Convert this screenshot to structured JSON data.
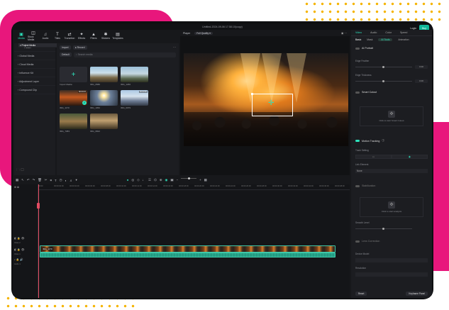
{
  "window": {
    "title": "Untitled-2024-09-06 17.58.10(copy)",
    "login": "Login",
    "buy": "Buy"
  },
  "toolbar": [
    {
      "label": "Media",
      "icon": "media-icon",
      "active": true
    },
    {
      "label": "Stock Media",
      "icon": "stock-media-icon"
    },
    {
      "label": "Audio",
      "icon": "audio-icon"
    },
    {
      "label": "Titles",
      "icon": "titles-icon"
    },
    {
      "label": "Transition",
      "icon": "transition-icon"
    },
    {
      "label": "Effects",
      "icon": "effects-icon"
    },
    {
      "label": "Filters",
      "icon": "filters-icon"
    },
    {
      "label": "Stickers",
      "icon": "stickers-icon"
    },
    {
      "label": "Templates",
      "icon": "templates-icon"
    }
  ],
  "sidebar": {
    "items": [
      "Project Media",
      "Folder",
      "Global Media",
      "Cloud Media",
      "Influence Kit",
      "Adjustment Layer",
      "Compound Clip"
    ]
  },
  "media": {
    "import_label": "Import",
    "record_label": "Record",
    "sort_label": "Default",
    "search_placeholder": "Search media",
    "items": [
      {
        "name": "Import Media",
        "kind": "import"
      },
      {
        "name": "IMG_0580",
        "kind": "t1"
      },
      {
        "name": "IMG_1266",
        "kind": "t2"
      },
      {
        "name": "IMG_1170",
        "kind": "t3",
        "duration": "00:00:15",
        "checked": true
      },
      {
        "name": "IMG_1052",
        "kind": "t4"
      },
      {
        "name": "IMG_0979",
        "kind": "t5",
        "duration": "00:00:50"
      },
      {
        "name": "IMG_7083",
        "kind": "t6"
      },
      {
        "name": "IMG_6822",
        "kind": "t7"
      }
    ]
  },
  "player": {
    "tab": "Player",
    "quality": "Full Quality",
    "current_time": "00:00:00:00",
    "total_time": "00:00:12:17"
  },
  "right_panel": {
    "tabs": [
      "Video",
      "Audio",
      "Color",
      "Speed"
    ],
    "subtabs": [
      "Basic",
      "Mask",
      "AI Tools",
      "Animation"
    ],
    "ai_portrait": "AI Portrait",
    "edge_feather": "Edge Feather",
    "edge_thickness": "Edge Thickness",
    "edge_feather_value": "0.00",
    "edge_thickness_value": "0.00",
    "smart_cutout": "Smart Cutout",
    "cutout_hint": "Click to start Smart Cutout",
    "motion_tracking": "Motion Tracking",
    "track_setting": "Track Setting",
    "link_element": "Link Element",
    "link_value": "None",
    "stabilization": "Stabilization",
    "stab_hint": "Click to start analysis",
    "smooth_level": "Smooth Level",
    "lens_correction": "Lens Correction",
    "device_model": "Device Model",
    "resolution": "Resolution",
    "reset": "Reset",
    "keyframe": "Keyframe Panel"
  },
  "timeline": {
    "ruler": [
      "00:00",
      "00:00:02:00",
      "00:00:04:00",
      "00:00:06:00",
      "00:00:08:00",
      "00:00:10:00",
      "00:00:12:00",
      "00:00:14:00",
      "00:00:16:00",
      "00:00:18:00",
      "00:00:20:00",
      "00:00:22:00",
      "00:00:24:00",
      "00:00:26:00",
      "00:00:28:00",
      "00:00:30:00",
      "00:00:32:00",
      "00:00:34:00",
      "00:00:36:00",
      "00:00:38:00"
    ],
    "tracks": [
      "Video 2",
      "Video 1",
      "Audio 1"
    ],
    "clip_label": "IMG_1170"
  }
}
